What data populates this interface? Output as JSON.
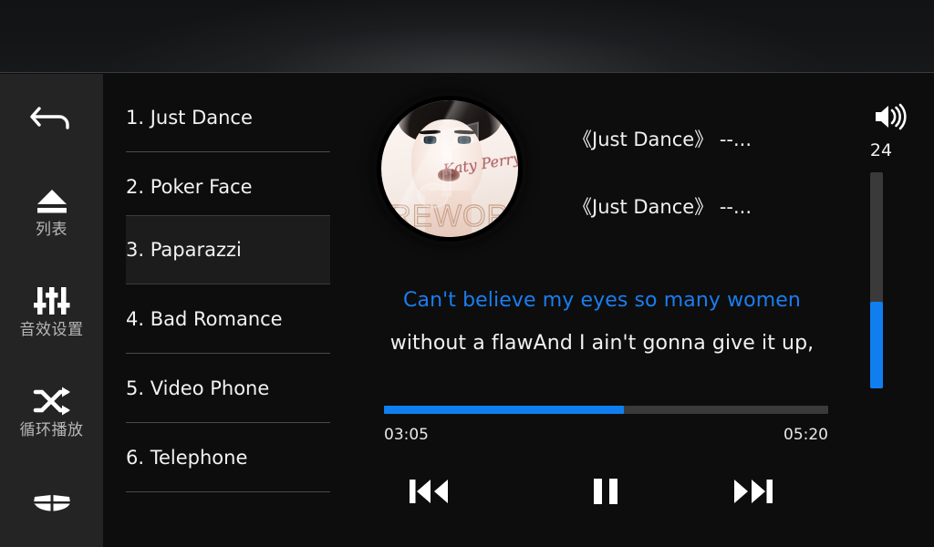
{
  "app": {
    "theme_bg": "#0d0d0d",
    "accent": "#0f7ff0",
    "sidebar_bg": "#242424"
  },
  "topbar": {
    "title": ""
  },
  "sidebar": {
    "items": [
      {
        "name": "back",
        "icon": "back-arrow-icon",
        "label": ""
      },
      {
        "name": "list",
        "icon": "eject-icon",
        "label": "列表"
      },
      {
        "name": "equalizer",
        "icon": "equalizer-icon",
        "label": "音效设置"
      },
      {
        "name": "loop",
        "icon": "shuffle-icon",
        "label": "循环播放"
      },
      {
        "name": "home",
        "icon": "home-grid-icon",
        "label": ""
      }
    ]
  },
  "playlist": {
    "selected_index": 2,
    "tracks": [
      {
        "label": "1. Just Dance"
      },
      {
        "label": "2. Poker Face"
      },
      {
        "label": "3. Paparazzi"
      },
      {
        "label": "4. Bad Romance"
      },
      {
        "label": "5. Video Phone"
      },
      {
        "label": "6. Telephone"
      }
    ]
  },
  "player": {
    "album_art": {
      "alt": "album-cover-woman-portrait",
      "artist_script": "Katy Perry",
      "cover_word": "REWORK",
      "watermark": "music-note-watermark"
    },
    "title_line1": "《Just Dance》 --...",
    "title_line2": "《Just Dance》 --...",
    "lyrics": {
      "current": "Can't believe my eyes so many women",
      "next": "without a flawAnd I ain't gonna give it up,",
      "current_color": "#1a7df0"
    },
    "progress": {
      "elapsed": "03:05",
      "total": "05:20",
      "percent": 54
    },
    "controls": {
      "previous": "previous-track",
      "play_pause": "pause",
      "next": "next-track"
    }
  },
  "volume": {
    "icon": "speaker-icon",
    "value": "24",
    "percent": 40
  }
}
